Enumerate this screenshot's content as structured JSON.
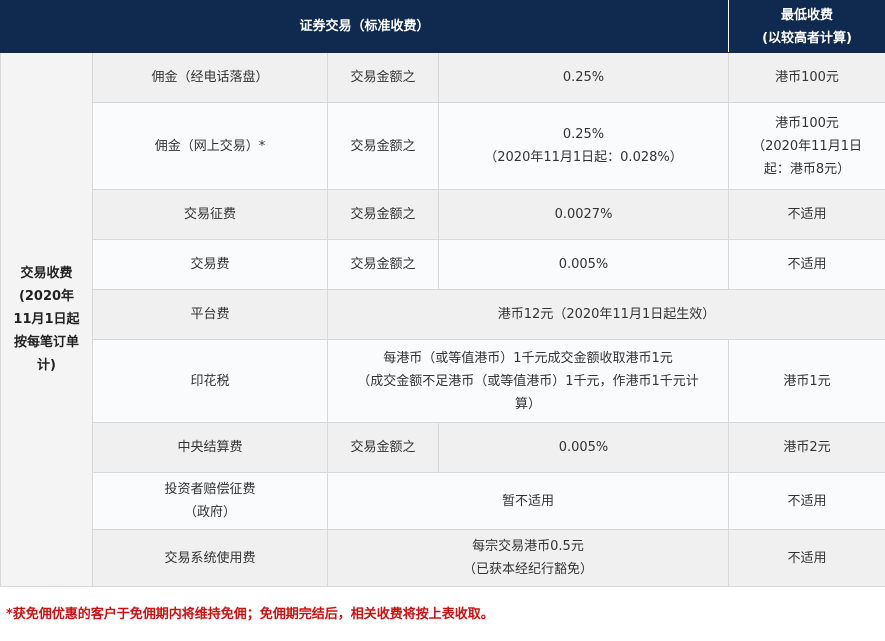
{
  "header": {
    "main": "证券交易（标准收费）",
    "min_line1": "最低收费",
    "min_line2": "(以较高者计算)"
  },
  "category": [
    "交易收费",
    "(2020年",
    "11月1日起",
    "按每笔订单",
    "计)"
  ],
  "rows": {
    "r1": {
      "name": "佣金（经电话落盘）",
      "basis": "交易金额之",
      "rate": "0.25%",
      "min": "港币100元"
    },
    "r2": {
      "name": "佣金（网上交易）*",
      "basis": "交易金额之",
      "rate_line1": "0.25%",
      "rate_line2": "（2020年11月1日起：0.028%）",
      "min_line1": "港币100元",
      "min_line2": "（2020年11月1日",
      "min_line3": "起：港币8元）"
    },
    "r3": {
      "name": "交易征费",
      "basis": "交易金额之",
      "rate": "0.0027%",
      "min": "不适用"
    },
    "r4": {
      "name": "交易费",
      "basis": "交易金额之",
      "rate": "0.005%",
      "min": "不适用"
    },
    "r5": {
      "name": "平台费",
      "detail": "港币12元（2020年11月1日起生效）"
    },
    "r6": {
      "name": "印花税",
      "detail_line1": "每港币（或等值港币）1千元成交金额收取港币1元",
      "detail_line2": "（成交金额不足港币（或等值港币）1千元，作港币1千元计",
      "detail_line3": "算）",
      "min": "港币1元"
    },
    "r7": {
      "name": "中央结算费",
      "basis": "交易金额之",
      "rate": "0.005%",
      "min": "港币2元"
    },
    "r8": {
      "name_line1": "投资者赔偿征费",
      "name_line2": "（政府）",
      "detail": "暂不适用",
      "min": "不适用"
    },
    "r9": {
      "name": "交易系统使用费",
      "detail_line1": "每宗交易港币0.5元",
      "detail_line2": "（已获本经纪行豁免）",
      "min": "不适用"
    }
  },
  "footnote": "*获免佣优惠的客户于免佣期内将维持免佣；免佣期完结后，相关收费将按上表收取。",
  "colors": {
    "header_bg": "#0f2a4e",
    "footnote": "#cc1111"
  }
}
